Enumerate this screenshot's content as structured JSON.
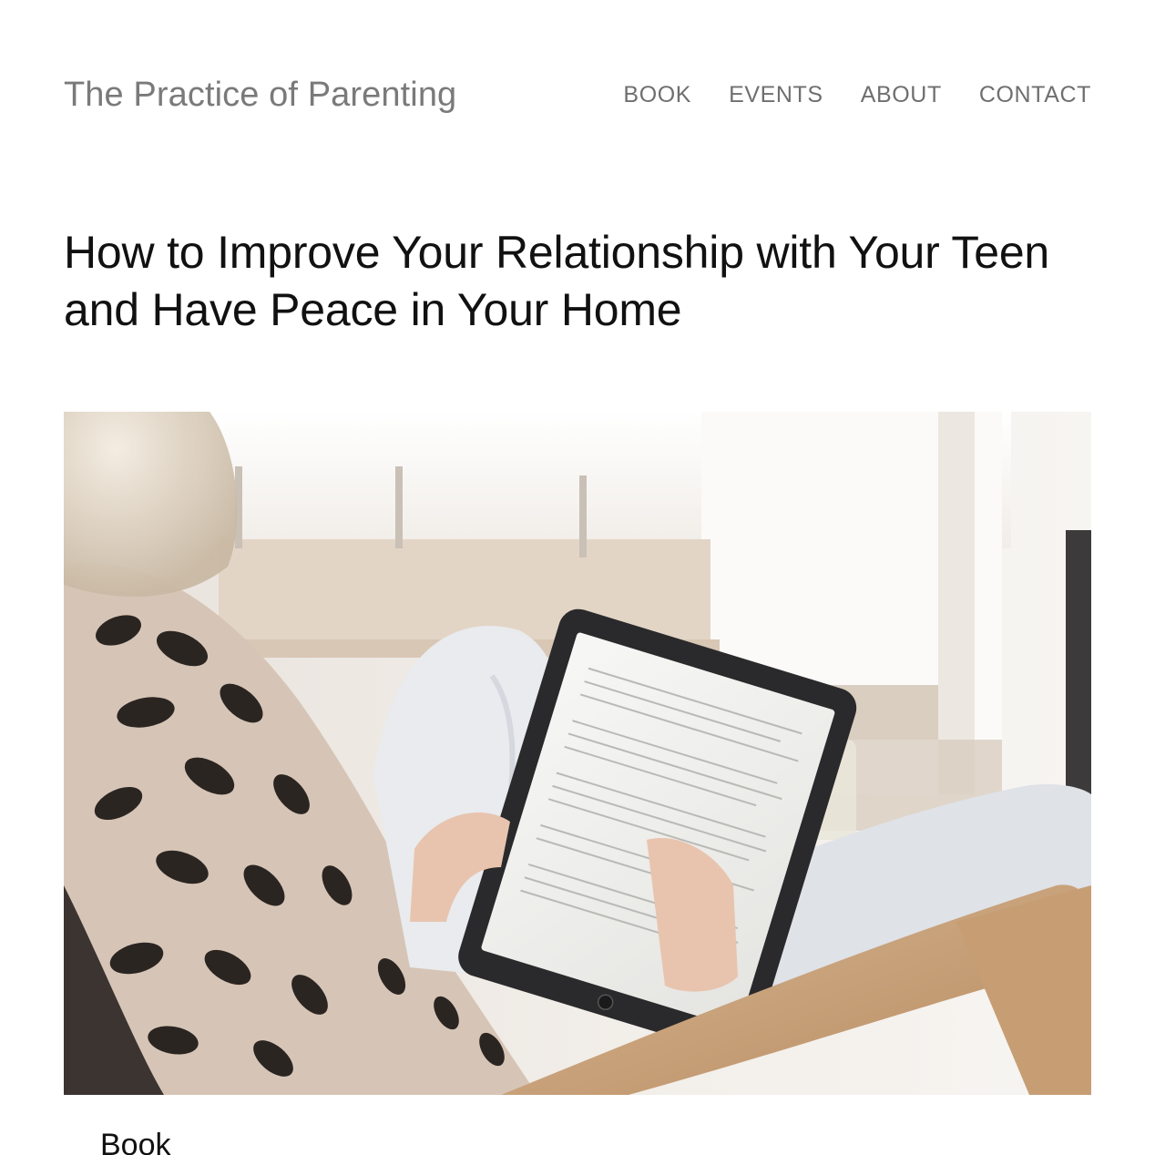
{
  "site": {
    "title": "The Practice of Parenting"
  },
  "nav": {
    "items": [
      {
        "label": "BOOK"
      },
      {
        "label": "EVENTS"
      },
      {
        "label": "ABOUT"
      },
      {
        "label": "CONTACT"
      }
    ]
  },
  "article": {
    "title": "How to Improve Your Relationship with Your Teen and Have Peace in Your Home"
  },
  "hero_image": {
    "icon": "photo-woman-reading-tablet"
  },
  "section": {
    "label": "Book"
  },
  "colors": {
    "site_title": "#7a7a7a",
    "nav_text": "#6f6f6f",
    "heading_text": "#111111",
    "background": "#ffffff"
  }
}
